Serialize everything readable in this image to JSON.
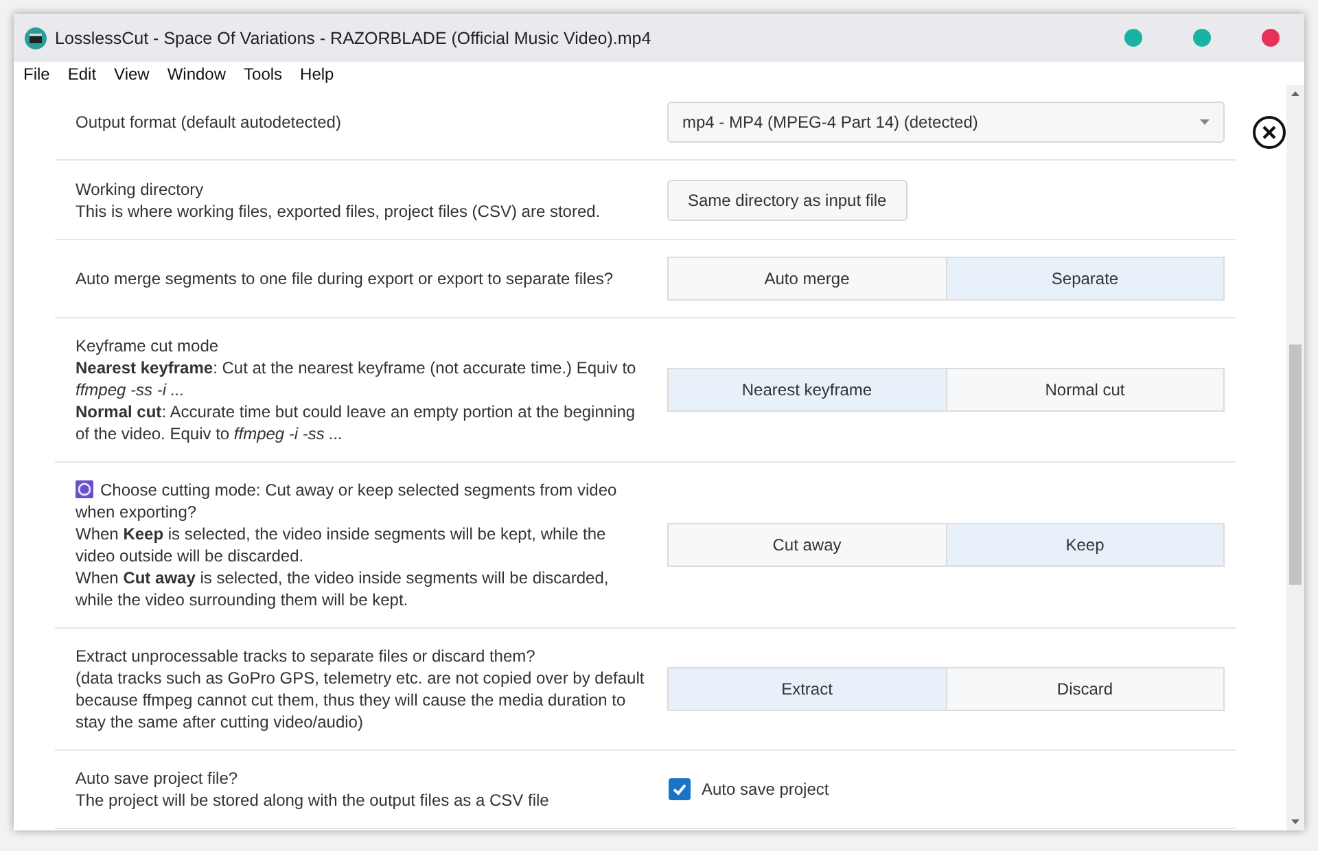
{
  "window": {
    "title": "LosslessCut - Space Of Variations - RAZORBLADE (Official Music Video).mp4"
  },
  "menu": [
    "File",
    "Edit",
    "View",
    "Window",
    "Tools",
    "Help"
  ],
  "settings": [
    {
      "kind": "select",
      "has_icon": false,
      "lines": [
        "Output format (default autodetected)"
      ],
      "value": "mp4 - MP4 (MPEG-4 Part 14) (detected)"
    },
    {
      "kind": "button",
      "has_icon": false,
      "lines": [
        "Working directory",
        "This is where working files, exported files, project files (CSV) are stored."
      ],
      "label": "Same directory as input file"
    },
    {
      "kind": "toggle",
      "has_icon": false,
      "lines": [
        "Auto merge segments to one file during export or export to separate files?"
      ],
      "options": [
        {
          "label": "Auto merge",
          "selected": false
        },
        {
          "label": "Separate",
          "selected": true
        }
      ]
    },
    {
      "kind": "toggle",
      "has_icon": false,
      "lines": [
        "Keyframe cut mode",
        "**Nearest keyframe**: Cut at the nearest keyframe (not accurate time.) Equiv to *ffmpeg -ss -i ...*",
        "**Normal cut**: Accurate time but could leave an empty portion at the beginning of the video. Equiv to *ffmpeg -i -ss ...*"
      ],
      "options": [
        {
          "label": "Nearest keyframe",
          "selected": true
        },
        {
          "label": "Normal cut",
          "selected": false
        }
      ]
    },
    {
      "kind": "toggle",
      "has_icon": true,
      "lines": [
        "Choose cutting mode: Cut away or keep selected segments from video when exporting?",
        "When **Keep** is selected, the video inside segments will be kept, while the video outside will be discarded.",
        "When **Cut away** is selected, the video inside segments will be discarded, while the video surrounding them will be kept."
      ],
      "options": [
        {
          "label": "Cut away",
          "selected": false
        },
        {
          "label": "Keep",
          "selected": true
        }
      ]
    },
    {
      "kind": "toggle",
      "has_icon": false,
      "lines": [
        "Extract unprocessable tracks to separate files or discard them?",
        "(data tracks such as GoPro GPS, telemetry etc. are not copied over by default because ffmpeg cannot cut them, thus they will cause the media duration to stay the same after cutting video/audio)"
      ],
      "options": [
        {
          "label": "Extract",
          "selected": true
        },
        {
          "label": "Discard",
          "selected": false
        }
      ]
    },
    {
      "kind": "checkbox",
      "has_icon": false,
      "lines": [
        "Auto save project file?",
        "The project will be stored along with the output files as a CSV file"
      ],
      "label": "Auto save project",
      "checked": true
    }
  ]
}
